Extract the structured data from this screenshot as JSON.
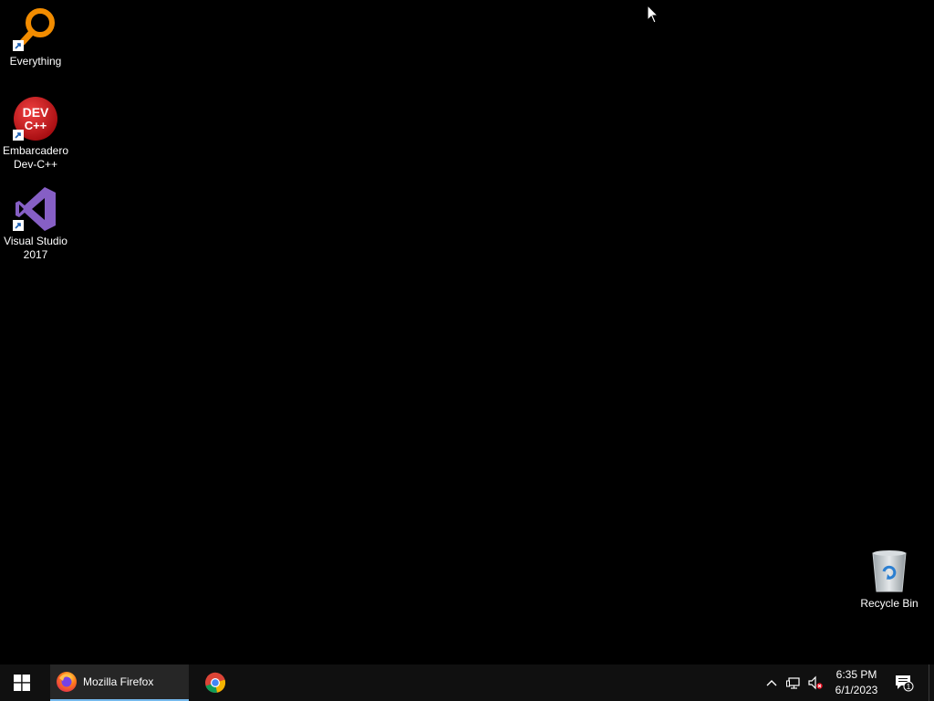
{
  "desktop": {
    "icons": [
      {
        "label": "Everything",
        "icon": "everything-magnifier-icon"
      },
      {
        "label": "Embarcadero Dev-C++",
        "icon": "devcpp-icon"
      },
      {
        "label": "Visual Studio 2017",
        "icon": "visual-studio-icon"
      },
      {
        "label": "Recycle Bin",
        "icon": "recycle-bin-icon"
      }
    ],
    "devcpp_logo_text_1": "DEV",
    "devcpp_logo_text_2": "C++"
  },
  "taskbar": {
    "start_icon": "windows-logo-icon",
    "tasks": [
      {
        "label": "Mozilla Firefox",
        "icon": "firefox-icon",
        "active": true
      },
      {
        "label": "",
        "icon": "chrome-icon",
        "active": false
      }
    ],
    "tray": {
      "icons": [
        "show-hidden-icons-chevron",
        "network-icon",
        "volume-muted-icon"
      ],
      "time": "6:35 PM",
      "date": "6/1/2023",
      "notification_count": "1"
    }
  },
  "colors": {
    "desktop_bg": "#000000",
    "taskbar_bg": "#101010",
    "active_task_bg": "#262626",
    "active_underline": "#76b9ed",
    "everything_orange": "#f28c00",
    "devcpp_red": "#d4191e",
    "vs_purple": "#865fc5"
  }
}
